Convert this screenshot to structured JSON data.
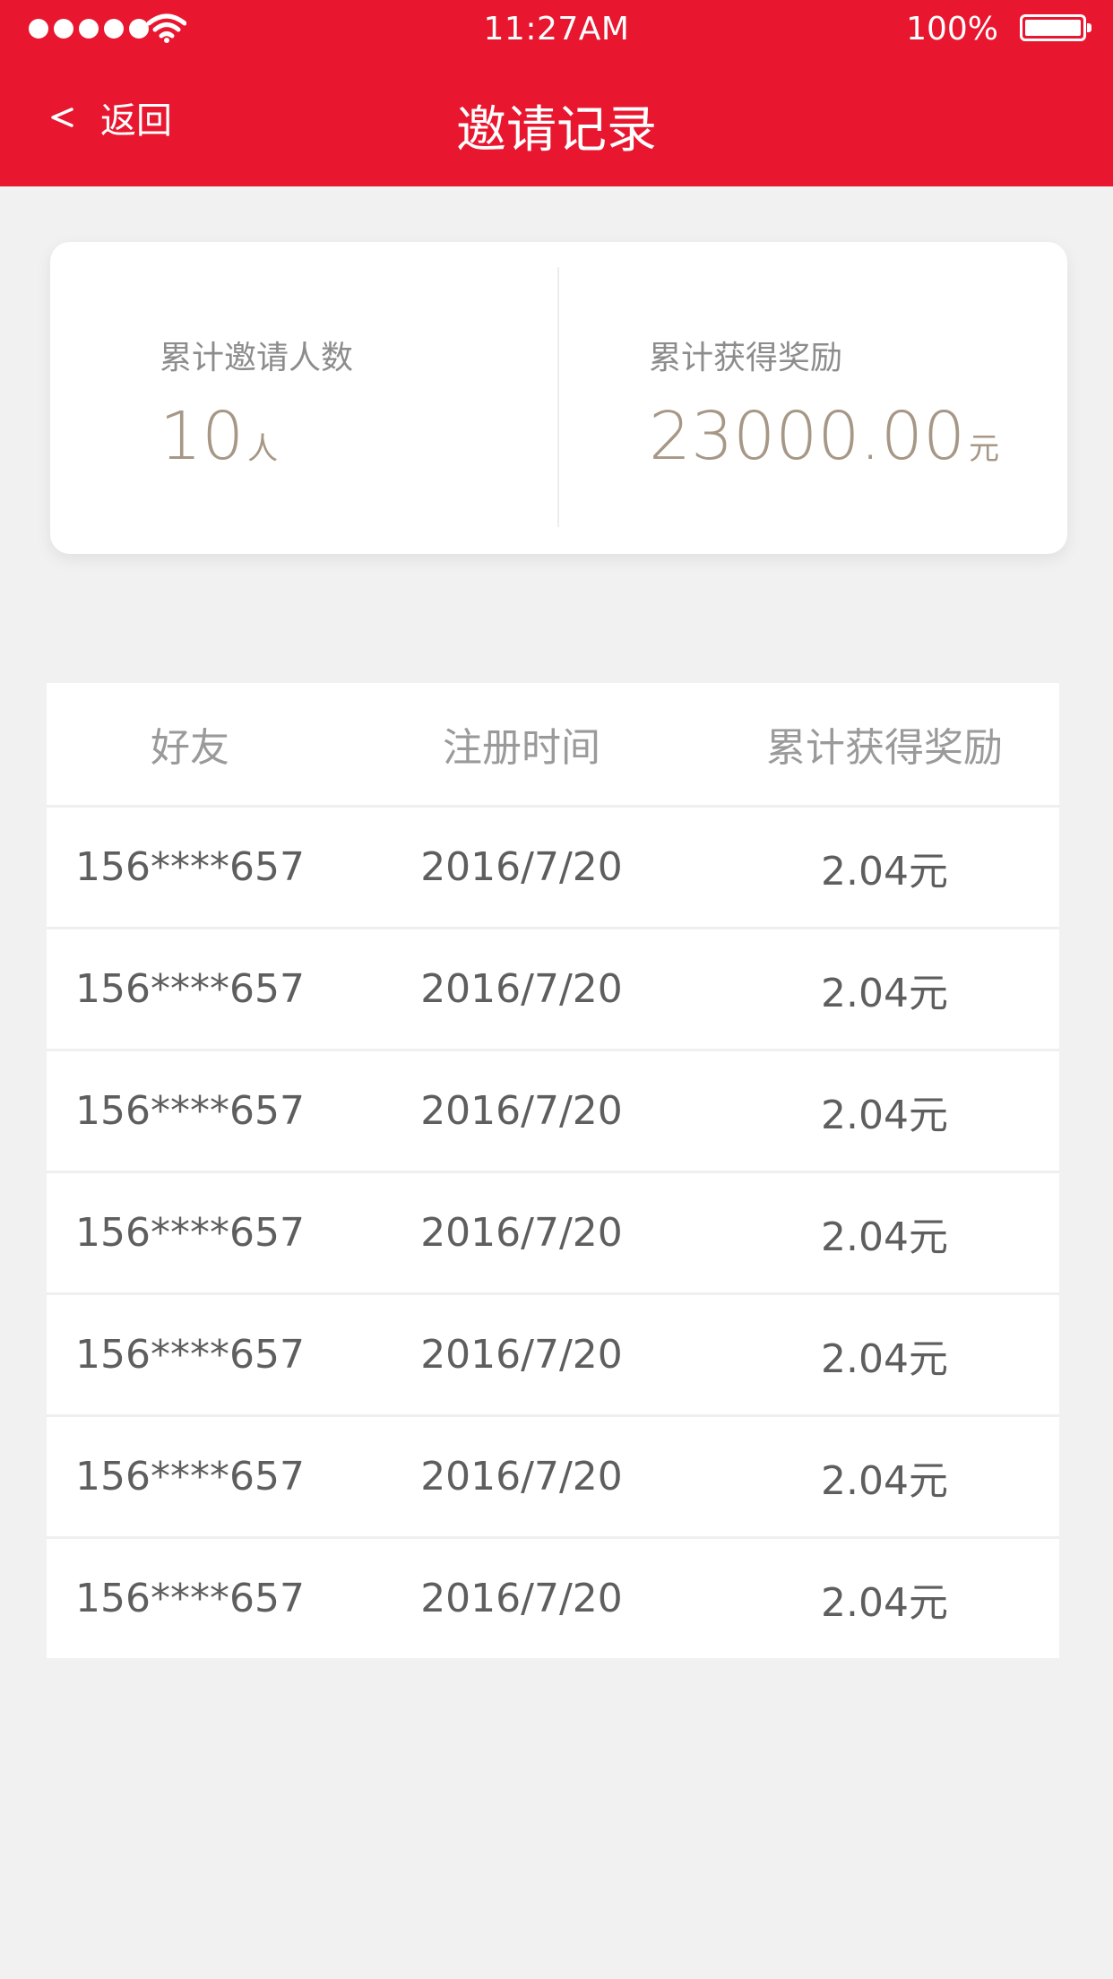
{
  "status_bar": {
    "time": "11:27AM",
    "battery_percent": "100%",
    "signal_dots": 5,
    "battery_level": 1.0
  },
  "nav": {
    "back_label": "返回",
    "title": "邀请记录"
  },
  "summary": {
    "invited_label": "累计邀请人数",
    "invited_value": "10",
    "invited_unit": "人",
    "reward_label": "累计获得奖励",
    "reward_value": "23000.00",
    "reward_unit": "元"
  },
  "table": {
    "headers": [
      "好友",
      "注册时间",
      "累计获得奖励"
    ],
    "rows": [
      {
        "friend": "156****657",
        "date": "2016/7/20",
        "reward": "2.04元"
      },
      {
        "friend": "156****657",
        "date": "2016/7/20",
        "reward": "2.04元"
      },
      {
        "friend": "156****657",
        "date": "2016/7/20",
        "reward": "2.04元"
      },
      {
        "friend": "156****657",
        "date": "2016/7/20",
        "reward": "2.04元"
      },
      {
        "friend": "156****657",
        "date": "2016/7/20",
        "reward": "2.04元"
      },
      {
        "friend": "156****657",
        "date": "2016/7/20",
        "reward": "2.04元"
      },
      {
        "friend": "156****657",
        "date": "2016/7/20",
        "reward": "2.04元"
      }
    ]
  },
  "colors": {
    "brand_red": "#e8172f",
    "accent_brown": "#a79786",
    "page_bg": "#f1f1f1"
  },
  "icons": {
    "back": "chevron-left-icon",
    "wifi": "wifi-icon",
    "battery": "battery-icon"
  }
}
